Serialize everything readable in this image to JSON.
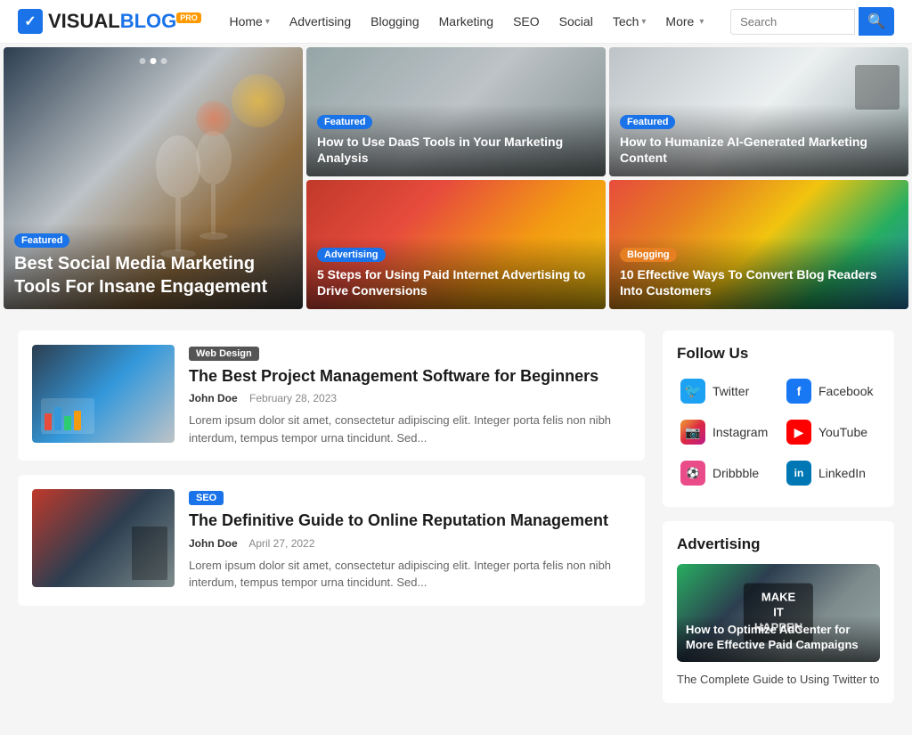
{
  "header": {
    "logo": {
      "check": "✓",
      "visual": "VISUAL",
      "blog": "BLOG",
      "pro": "PRO"
    },
    "nav": [
      {
        "label": "Home",
        "hasDropdown": true
      },
      {
        "label": "Advertising",
        "hasDropdown": false
      },
      {
        "label": "Blogging",
        "hasDropdown": false
      },
      {
        "label": "Marketing",
        "hasDropdown": false
      },
      {
        "label": "SEO",
        "hasDropdown": false
      },
      {
        "label": "Social",
        "hasDropdown": false
      },
      {
        "label": "Tech",
        "hasDropdown": true
      },
      {
        "label": "More",
        "hasDropdown": true
      }
    ],
    "search": {
      "placeholder": "Search",
      "button_icon": "🔍"
    }
  },
  "hero": {
    "large": {
      "tag": "Featured",
      "tag_class": "tag-featured",
      "title": "Best Social Media Marketing Tools For Insane Engagement"
    },
    "top_right_1": {
      "tag": "Featured",
      "tag_class": "tag-featured",
      "title": "How to Use DaaS Tools in Your Marketing Analysis"
    },
    "top_right_2": {
      "tag": "Featured",
      "tag_class": "tag-featured",
      "title": "How to Humanize AI-Generated Marketing Content"
    },
    "bottom_right_1": {
      "tag": "Advertising",
      "tag_class": "tag-advertising",
      "title": "5 Steps for Using Paid Internet Advertising to Drive Conversions"
    },
    "bottom_right_2": {
      "tag": "Blogging",
      "tag_class": "tag-blogging",
      "title": "10 Effective Ways To Convert Blog Readers Into Customers"
    }
  },
  "articles": [
    {
      "tag": "Web Design",
      "tag_class": "tag-webdesign",
      "title": "The Best Project Management Software for Beginners",
      "author": "John Doe",
      "date": "February 28, 2023",
      "excerpt": "Lorem ipsum dolor sit amet, consectetur adipiscing elit. Integer porta felis non nibh interdum, tempus tempor urna tincidunt. Sed...",
      "img_class": "img-laptop-chart"
    },
    {
      "tag": "SEO",
      "tag_class": "tag-seo",
      "title": "The Definitive Guide to Online Reputation Management",
      "author": "John Doe",
      "date": "April 27, 2022",
      "excerpt": "Lorem ipsum dolor sit amet, consectetur adipiscing elit. Integer porta felis non nibh interdum, tempus tempor urna tincidunt. Sed...",
      "img_class": "img-laptop-hand"
    }
  ],
  "sidebar": {
    "follow_title": "Follow Us",
    "social_items": [
      {
        "name": "Twitter",
        "icon_class": "icon-twitter",
        "icon": "🐦"
      },
      {
        "name": "Facebook",
        "icon_class": "icon-facebook",
        "icon": "f"
      },
      {
        "name": "Instagram",
        "icon_class": "icon-instagram",
        "icon": "📷"
      },
      {
        "name": "YouTube",
        "icon_class": "icon-youtube",
        "icon": "▶"
      },
      {
        "name": "Dribbble",
        "icon_class": "icon-dribbble",
        "icon": "⚽"
      },
      {
        "name": "LinkedIn",
        "icon_class": "icon-linkedin",
        "icon": "in"
      }
    ],
    "advertising_title": "Advertising",
    "ad_card_title": "How to Optimize AdCenter for More Effective Paid Campaigns",
    "sidebar_link": "The Complete Guide to Using Twitter to"
  }
}
